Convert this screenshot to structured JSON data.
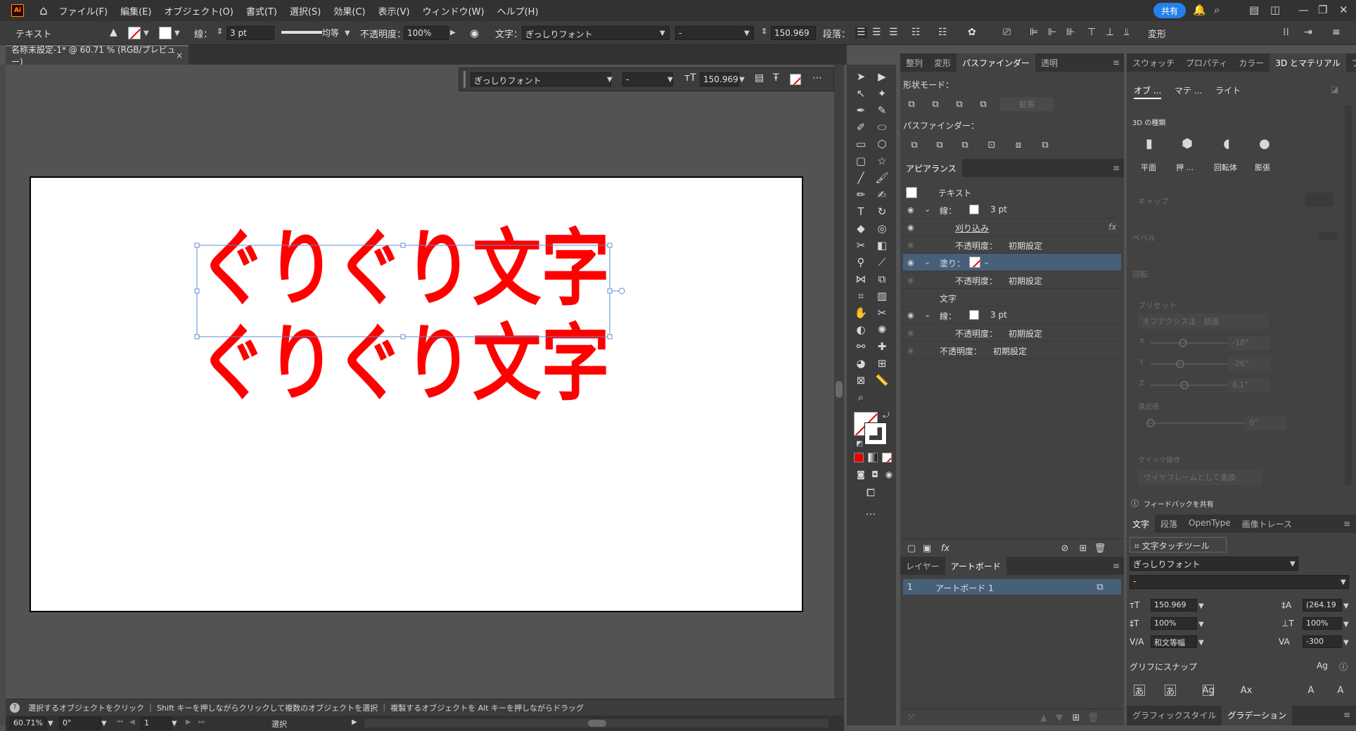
{
  "menu": {
    "logo": "Ai",
    "items": [
      "ファイル(F)",
      "編集(E)",
      "オブジェクト(O)",
      "書式(T)",
      "選択(S)",
      "効果(C)",
      "表示(V)",
      "ウィンドウ(W)",
      "ヘルプ(H)"
    ],
    "share": "共有"
  },
  "control": {
    "mode": "テキスト",
    "stroke_label": "線：",
    "stroke_value": "3 pt",
    "profile": "均等",
    "opacity_label": "不透明度：",
    "opacity_value": "100%",
    "char_label": "文字：",
    "font": "ぎっしりフォント",
    "style": "-",
    "size": "150.969",
    "para_label": "段落：",
    "transform": "変形"
  },
  "doc": {
    "tab_title": "名称未設定-1* @ 60.71 % (RGB/プレビュー)",
    "close": "×"
  },
  "floatbar": {
    "font": "ぎっしりフォント",
    "style": "-",
    "size": "150.969"
  },
  "panel_top": {
    "tabs": [
      "整列",
      "変形",
      "パスファインダー",
      "透明"
    ],
    "shape_modes": "形状モード：",
    "expand": "拡張",
    "pathfinder": "パスファインダー："
  },
  "appearance": {
    "tab": "アピアランス",
    "title": "テキスト",
    "rows": [
      {
        "label": "線：",
        "value": "3 pt"
      },
      {
        "label": "刈り込み",
        "value": ""
      },
      {
        "label": "不透明度：",
        "value": "初期設定"
      },
      {
        "label": "塗り：",
        "value": ""
      },
      {
        "label": "不透明度：",
        "value": "初期設定"
      },
      {
        "label": "文字",
        "value": ""
      },
      {
        "label": "線：",
        "value": "3 pt"
      },
      {
        "label": "不透明度：",
        "value": "初期設定"
      },
      {
        "label": "不透明度：",
        "value": "初期設定"
      }
    ],
    "fx": "fx"
  },
  "layers": {
    "tabs": [
      "レイヤー",
      "アートボード"
    ],
    "row_num": "1",
    "row_name": "アートボード 1"
  },
  "panel_right": {
    "tabs": [
      "スウォッチ",
      "プロパティ",
      "カラー",
      "3D とマテリアル",
      "ブラシ"
    ],
    "subtabs": [
      "オブ ...",
      "マテ ...",
      "ライト"
    ],
    "type_heading": "3D の種類",
    "types": [
      "平面",
      "押 ...",
      "回転体",
      "膨張"
    ],
    "cap": "キャップ",
    "bevel": "ベベル",
    "rotate": "回転",
    "preset_label": "プリセット",
    "preset_value": "オフアクシス法 - 前面",
    "x_label": "X",
    "x_value": "-18°",
    "y_label": "Y",
    "y_value": "-26°",
    "z_label": "Z",
    "z_value": "8.1°",
    "perspective": "遠近感",
    "persp_value": "0°",
    "quick": "クイック操作",
    "wireframe": "ワイヤフレームとして書換",
    "feedback": "フィードバックを共有"
  },
  "character": {
    "tabs": [
      "文字",
      "段落",
      "OpenType",
      "画像トレース"
    ],
    "touch_tool": "文字タッチツール",
    "font": "ぎっしりフォント",
    "style": "-",
    "size": "150.969",
    "leading": "(264.19",
    "vscale": "100%",
    "hscale": "100%",
    "kerning": "和文等幅",
    "tracking": "-300",
    "snap": "グリフにスナップ"
  },
  "bottom_tabs": [
    "グラフィックスタイル",
    "グラデーション"
  ],
  "status": {
    "hint": "選択するオブジェクトをクリック ｜ Shift キーを押しながらクリックして複数のオブジェクトを選択 ｜ 複製するオブジェクトを Alt キーを押しながらドラッグ",
    "zoom": "60.71%",
    "angle": "0°",
    "page": "1",
    "tool": "選択"
  },
  "artwork": {
    "text_line1": "ぐりぐり文字",
    "text_line2": "ぐりぐり文字",
    "color": "#ff0000"
  },
  "colors": {
    "accent": "#2680eb",
    "selected_row": "#46607a"
  }
}
